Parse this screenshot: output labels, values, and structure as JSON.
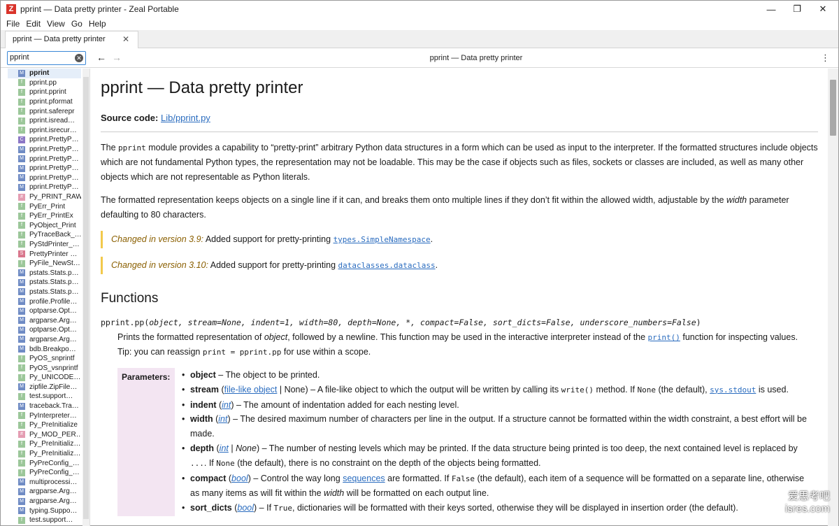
{
  "window": {
    "title": "pprint — Data pretty printer - Zeal Portable",
    "app_icon": "Z"
  },
  "menu": [
    "File",
    "Edit",
    "View",
    "Go",
    "Help"
  ],
  "tab": {
    "label": "pprint — Data pretty printer"
  },
  "search": {
    "value": "pprint"
  },
  "toolbar": {
    "title": "pprint — Data pretty printer"
  },
  "sidebar": {
    "items": [
      {
        "badge": "M",
        "text": "pprint"
      },
      {
        "badge": "f",
        "text": "pprint.pp"
      },
      {
        "badge": "f",
        "text": "pprint.pprint"
      },
      {
        "badge": "f",
        "text": "pprint.pformat"
      },
      {
        "badge": "f",
        "text": "pprint.saferepr"
      },
      {
        "badge": "f",
        "text": "pprint.isread…"
      },
      {
        "badge": "f",
        "text": "pprint.isrecur…"
      },
      {
        "badge": "C",
        "text": "pprint.PrettyP…"
      },
      {
        "badge": "M",
        "text": "pprint.PrettyP…"
      },
      {
        "badge": "M",
        "text": "pprint.PrettyP…"
      },
      {
        "badge": "M",
        "text": "pprint.PrettyP…"
      },
      {
        "badge": "M",
        "text": "pprint.PrettyP…"
      },
      {
        "badge": "M",
        "text": "pprint.PrettyP…"
      },
      {
        "badge": "#",
        "text": "Py_PRINT_RAW"
      },
      {
        "badge": "f",
        "text": "PyErr_Print"
      },
      {
        "badge": "f",
        "text": "PyErr_PrintEx"
      },
      {
        "badge": "f",
        "text": "PyObject_Print"
      },
      {
        "badge": "f",
        "text": "PyTraceBack_…"
      },
      {
        "badge": "f",
        "text": "PyStdPrinter_…"
      },
      {
        "badge": "S",
        "text": "PrettyPrinter …"
      },
      {
        "badge": "f",
        "text": "PyFile_NewSt…"
      },
      {
        "badge": "M",
        "text": "pstats.Stats.p…"
      },
      {
        "badge": "M",
        "text": "pstats.Stats.p…"
      },
      {
        "badge": "M",
        "text": "pstats.Stats.p…"
      },
      {
        "badge": "M",
        "text": "profile.Profile…"
      },
      {
        "badge": "M",
        "text": "optparse.Opt…"
      },
      {
        "badge": "M",
        "text": "argparse.Arg…"
      },
      {
        "badge": "M",
        "text": "optparse.Opt…"
      },
      {
        "badge": "M",
        "text": "argparse.Arg…"
      },
      {
        "badge": "M",
        "text": "bdb.Breakpo…"
      },
      {
        "badge": "f",
        "text": "PyOS_snprintf"
      },
      {
        "badge": "f",
        "text": "PyOS_vsnprintf"
      },
      {
        "badge": "f",
        "text": "Py_UNICODE…"
      },
      {
        "badge": "M",
        "text": "zipfile.ZipFile…"
      },
      {
        "badge": "f",
        "text": "test.support…"
      },
      {
        "badge": "M",
        "text": "traceback.Tra…"
      },
      {
        "badge": "f",
        "text": "PyInterpreter…"
      },
      {
        "badge": "f",
        "text": "Py_PreInitialize"
      },
      {
        "badge": "#",
        "text": "Py_MOD_PER…"
      },
      {
        "badge": "f",
        "text": "Py_PreInitializ…"
      },
      {
        "badge": "f",
        "text": "Py_PreInitializ…"
      },
      {
        "badge": "f",
        "text": "PyPreConfig_…"
      },
      {
        "badge": "f",
        "text": "PyPreConfig_…"
      },
      {
        "badge": "M",
        "text": "multiprocessi…"
      },
      {
        "badge": "M",
        "text": "argparse.Arg…"
      },
      {
        "badge": "M",
        "text": "argparse.Arg…"
      },
      {
        "badge": "M",
        "text": "typing.Suppo…"
      },
      {
        "badge": "f",
        "text": "test.support…"
      }
    ]
  },
  "doc": {
    "title": "pprint — Data pretty printer",
    "source_label": "Source code:",
    "source_link": "Lib/pprint.py",
    "para1_a": "The ",
    "para1_code": "pprint",
    "para1_b": " module provides a capability to “pretty-print” arbitrary Python data structures in a form which can be used as input to the interpreter. If the formatted structures include objects which are not fundamental Python types, the representation may not be loadable. This may be the case if objects such as files, sockets or classes are included, as well as many other objects which are not representable as Python literals.",
    "para2_a": "The formatted representation keeps objects on a single line if it can, and breaks them onto multiple lines if they don’t fit within the allowed width, adjustable by the ",
    "para2_em": "width",
    "para2_b": " parameter defaulting to 80 characters.",
    "change1_ver": "Changed in version 3.9:",
    "change1_text": " Added support for pretty-printing ",
    "change1_code": "types.SimpleNamespace",
    "change2_ver": "Changed in version 3.10:",
    "change2_text": " Added support for pretty-printing ",
    "change2_code": "dataclasses.dataclass",
    "functions_heading": "Functions",
    "sig_name": "pprint.pp",
    "sig_args": "object, stream=None, indent=1, width=80, depth=None, *, compact=False, sort_dicts=False, underscore_numbers=False",
    "desc_a": "Prints the formatted representation of ",
    "desc_em": "object",
    "desc_b": ", followed by a newline. This function may be used in the interactive interpreter instead of the ",
    "desc_link": "print()",
    "desc_c": " function for inspecting values.",
    "tip_a": "Tip: you can reassign ",
    "tip_code": "print = pprint.pp",
    "tip_b": " for use within a scope.",
    "params_label": "Parameters:"
  },
  "watermark": {
    "line1": "爱思考吧",
    "line2": "isres.com"
  }
}
